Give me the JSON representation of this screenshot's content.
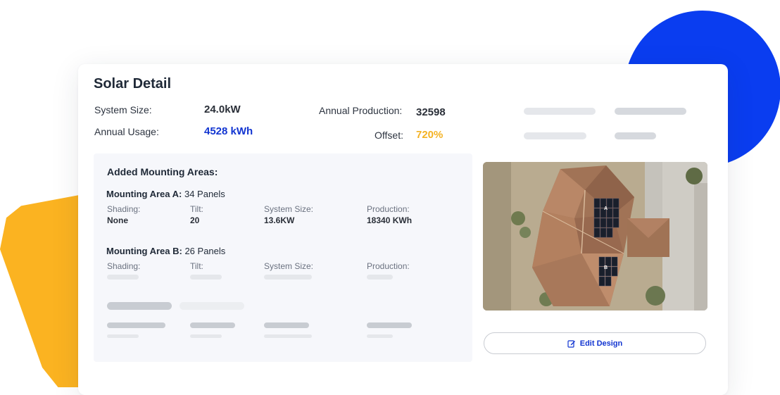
{
  "card": {
    "title": "Solar Detail",
    "system_size_label": "System Size:",
    "system_size_value": "24.0kW",
    "annual_usage_label": "Annual Usage:",
    "annual_usage_value": "4528 kWh",
    "annual_production_label": "Annual Production:",
    "annual_production_value": "32598",
    "offset_label": "Offset:",
    "offset_value": "720%"
  },
  "mounting": {
    "title": "Added Mounting Areas:",
    "areas": [
      {
        "name": "Mounting Area A:",
        "panels": " 34 Panels",
        "shading_label": "Shading:",
        "shading_value": "None",
        "tilt_label": "Tilt:",
        "tilt_value": "20",
        "system_size_label": "System Size:",
        "system_size_value": "13.6KW",
        "production_label": "Production:",
        "production_value": "18340 KWh"
      },
      {
        "name": "Mounting Area B:",
        "panels": " 26 Panels",
        "shading_label": "Shading:",
        "tilt_label": "Tilt:",
        "system_size_label": "System Size:",
        "production_label": "Production:"
      }
    ]
  },
  "map": {
    "area_a_marker": "A",
    "area_b_marker": "B"
  },
  "actions": {
    "edit_design_label": "Edit Design",
    "edit_icon": "edit-icon"
  },
  "colors": {
    "brand_blue": "#1235d1",
    "accent_orange": "#f4b223",
    "blob_blue": "#0a3df0",
    "blob_yellow": "#fbb321"
  }
}
